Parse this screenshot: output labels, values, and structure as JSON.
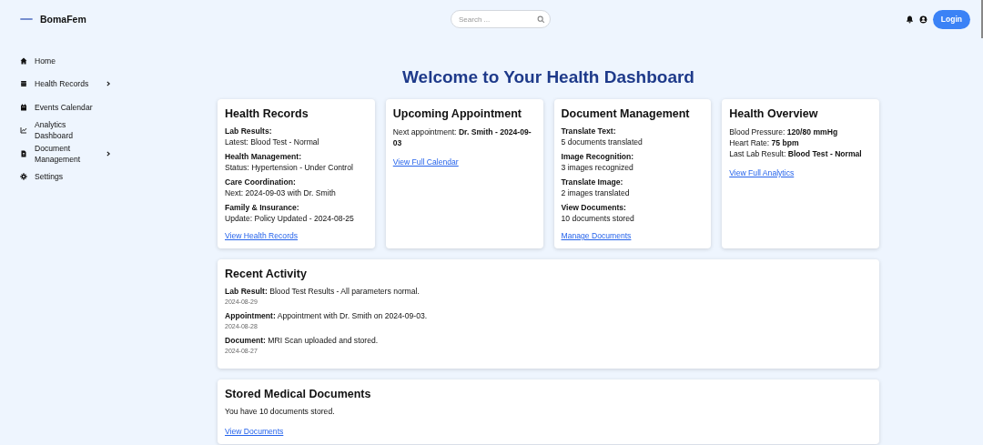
{
  "header": {
    "brand": "BomaFem",
    "search": {
      "placeholder": "Search ..."
    },
    "login": "Login"
  },
  "sidebar": {
    "items": [
      {
        "label": "Home",
        "expandable": false
      },
      {
        "label": "Health Records",
        "expandable": true
      },
      {
        "label": "Events Calendar",
        "expandable": false
      },
      {
        "label": "Analytics Dashboard",
        "expandable": false
      },
      {
        "label": "Document Management",
        "expandable": true
      },
      {
        "label": "Settings",
        "expandable": false
      }
    ]
  },
  "title": "Welcome to Your Health Dashboard",
  "cards": [
    {
      "kind": "sections",
      "title": "Health Records",
      "sections": [
        {
          "label": "Lab Results:",
          "value": "Latest: Blood Test - Normal"
        },
        {
          "label": "Health Management:",
          "value": "Status: Hypertension - Under Control"
        },
        {
          "label": "Care Coordination:",
          "value": "Next: 2024-09-03 with Dr. Smith"
        },
        {
          "label": "Family & Insurance:",
          "value": "Update: Policy Updated - 2024-08-25"
        }
      ],
      "link": "View Health Records"
    },
    {
      "kind": "lines",
      "title": "Upcoming Appointment",
      "lines": [
        "Next appointment: **Dr. Smith - 2024-09-03**"
      ],
      "link": "View Full Calendar"
    },
    {
      "kind": "sections",
      "title": "Document Management",
      "sections": [
        {
          "label": "Translate Text:",
          "value": "5 documents translated"
        },
        {
          "label": "Image Recognition:",
          "value": "3 images recognized"
        },
        {
          "label": "Translate Image:",
          "value": "2 images translated"
        },
        {
          "label": "View Documents:",
          "value": "10 documents stored"
        }
      ],
      "link": "Manage Documents"
    },
    {
      "kind": "lines",
      "title": "Health Overview",
      "lines": [
        "Blood Pressure: **120/80 mmHg**",
        "Heart Rate: **75 bpm**",
        "Last Lab Result: **Blood Test - Normal**"
      ],
      "link": "View Full Analytics"
    }
  ],
  "recent_activity": {
    "title": "Recent Activity",
    "items": [
      {
        "text": "**Lab Result:** Blood Test Results - All parameters normal.",
        "date": "2024-08-29"
      },
      {
        "text": "**Appointment:** Appointment with Dr. Smith on 2024-09-03.",
        "date": "2024-08-28"
      },
      {
        "text": "**Document:** MRI Scan uploaded and stored.",
        "date": "2024-08-27"
      }
    ]
  },
  "stored_documents": {
    "title": "Stored Medical Documents",
    "text": "You have 10 documents stored.",
    "link": "View Documents"
  }
}
